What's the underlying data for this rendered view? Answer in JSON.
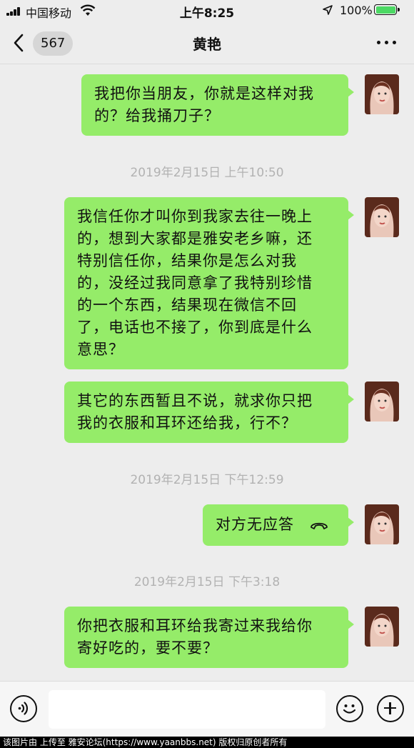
{
  "status_bar": {
    "carrier": "中国移动",
    "time": "上午8:25",
    "battery_percent": "100%",
    "battery_level": 1.0,
    "icons": [
      "signal-icon",
      "wifi-icon",
      "location-icon",
      "battery-icon"
    ]
  },
  "header": {
    "back_count": "567",
    "title": "黄艳",
    "icons": [
      "chevron-left-icon",
      "more-dots-icon"
    ]
  },
  "messages": [
    {
      "type": "text",
      "sender": "self",
      "text": "我把你当朋友，你就是这样对我\n的？给我捅刀子？"
    },
    {
      "type": "timestamp",
      "text": "2019年2月15日 上午10:50"
    },
    {
      "type": "text",
      "sender": "self",
      "text": "我信任你才叫你到我家去往一晚上\n的，想到大家都是雅安老乡嘛，还\n特别信任你，结果你是怎么对我\n的，没经过我同意拿了我特别珍惜\n的一个东西，结果现在微信不回\n了，电话也不接了，你到底是什么\n意思？"
    },
    {
      "type": "text",
      "sender": "self",
      "text": "其它的东西暂且不说，就求你只把\n我的衣服和耳环还给我，行不？"
    },
    {
      "type": "timestamp",
      "text": "2019年2月15日 下午12:59"
    },
    {
      "type": "call",
      "sender": "self",
      "text": "对方无应答",
      "icon": "phone-hangup-icon"
    },
    {
      "type": "timestamp",
      "text": "2019年2月15日 下午3:18"
    },
    {
      "type": "text",
      "sender": "self",
      "text": "你把衣服和耳环给我寄过来我给你\n寄好吃的，要不要？"
    }
  ],
  "input_bar": {
    "placeholder": "",
    "icons": [
      "voice-icon",
      "emoji-icon",
      "plus-icon"
    ]
  },
  "watermark": "该图片由  上传至 雅安论坛(https://www.yaanbbs.net) 版权归原创者所有",
  "colors": {
    "background": "#ededed",
    "bubble_self": "#95ec69",
    "timestamp": "#b2b2b2",
    "battery_fill": "#4cd964"
  }
}
